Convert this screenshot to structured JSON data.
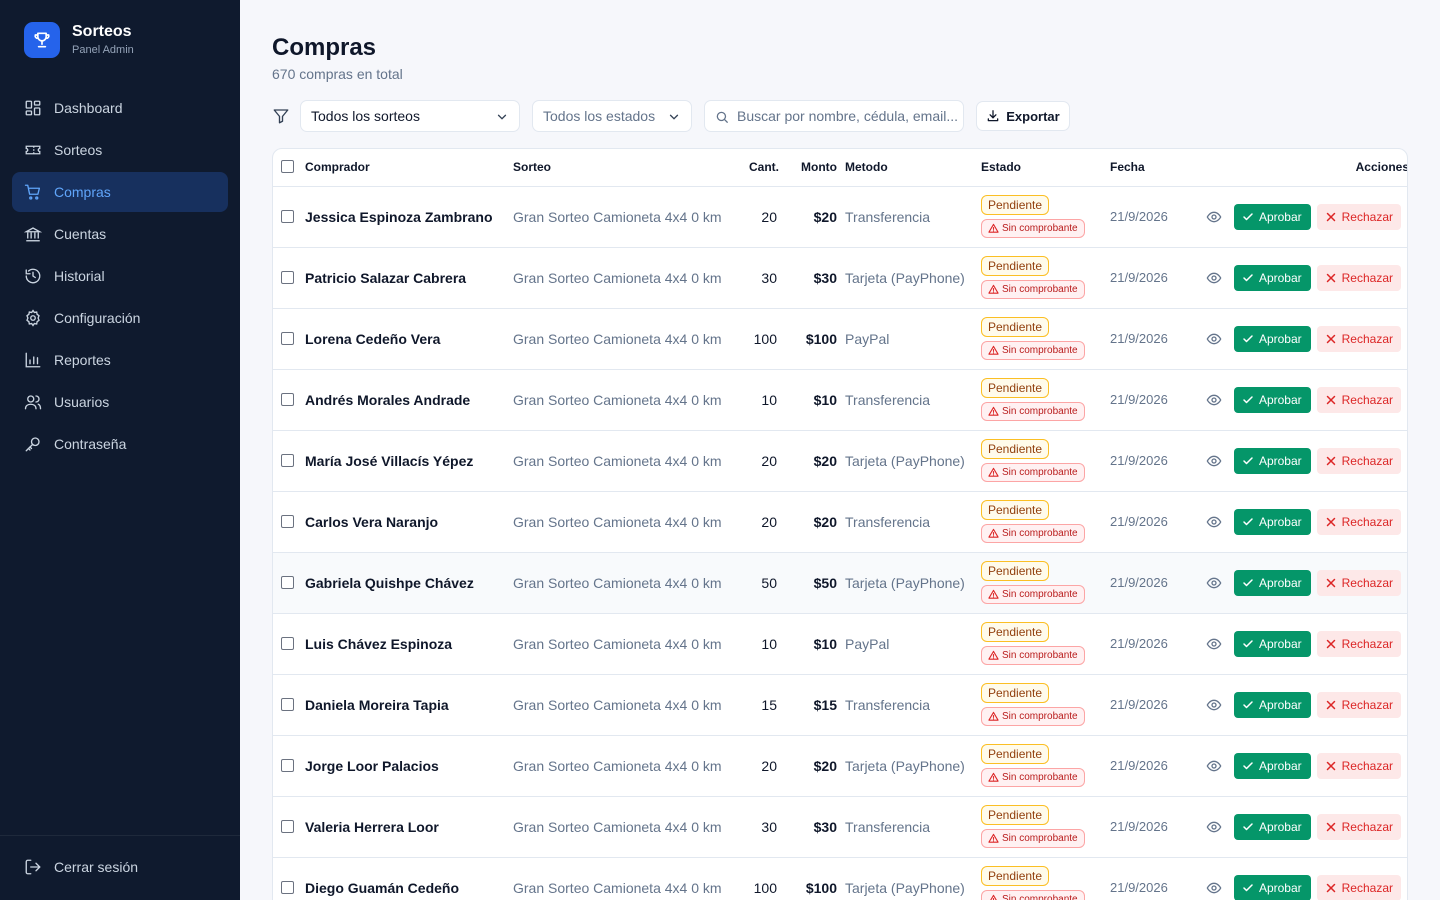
{
  "brand": {
    "title": "Sorteos",
    "subtitle": "Panel Admin",
    "icon": "trophy-icon"
  },
  "sidebar": {
    "items": [
      {
        "label": "Dashboard",
        "icon": "dashboard-icon",
        "active": false
      },
      {
        "label": "Sorteos",
        "icon": "ticket-icon",
        "active": false
      },
      {
        "label": "Compras",
        "icon": "cart-icon",
        "active": true
      },
      {
        "label": "Cuentas",
        "icon": "bank-icon",
        "active": false
      },
      {
        "label": "Historial",
        "icon": "history-icon",
        "active": false
      },
      {
        "label": "Configuración",
        "icon": "gear-icon",
        "active": false
      },
      {
        "label": "Reportes",
        "icon": "bar-chart-icon",
        "active": false
      },
      {
        "label": "Usuarios",
        "icon": "users-icon",
        "active": false
      },
      {
        "label": "Contraseña",
        "icon": "key-icon",
        "active": false
      }
    ],
    "logout_label": "Cerrar sesión"
  },
  "page": {
    "title": "Compras",
    "subtitle": "670 compras en total"
  },
  "filters": {
    "raffle_selected": "Todos los sorteos",
    "status_selected": "Todos los estados",
    "search_placeholder": "Buscar por nombre, cédula, email...",
    "export_label": "Exportar"
  },
  "table": {
    "headers": {
      "buyer": "Comprador",
      "raffle": "Sorteo",
      "qty": "Cant.",
      "amount": "Monto",
      "method": "Metodo",
      "status": "Estado",
      "date": "Fecha",
      "actions": "Acciones"
    },
    "status_label": "Pendiente",
    "no_receipt_label": "Sin comprobante",
    "approve_label": "Aprobar",
    "reject_label": "Rechazar",
    "rows": [
      {
        "buyer": "Jessica Espinoza Zambrano",
        "raffle": "Gran Sorteo Camioneta 4x4 0 km",
        "qty": "20",
        "amount": "$20",
        "method": "Transferencia",
        "date": "21/9/2026"
      },
      {
        "buyer": "Patricio Salazar Cabrera",
        "raffle": "Gran Sorteo Camioneta 4x4 0 km",
        "qty": "30",
        "amount": "$30",
        "method": "Tarjeta (PayPhone)",
        "date": "21/9/2026"
      },
      {
        "buyer": "Lorena Cedeño Vera",
        "raffle": "Gran Sorteo Camioneta 4x4 0 km",
        "qty": "100",
        "amount": "$100",
        "method": "PayPal",
        "date": "21/9/2026"
      },
      {
        "buyer": "Andrés Morales Andrade",
        "raffle": "Gran Sorteo Camioneta 4x4 0 km",
        "qty": "10",
        "amount": "$10",
        "method": "Transferencia",
        "date": "21/9/2026"
      },
      {
        "buyer": "María José Villacís Yépez",
        "raffle": "Gran Sorteo Camioneta 4x4 0 km",
        "qty": "20",
        "amount": "$20",
        "method": "Tarjeta (PayPhone)",
        "date": "21/9/2026"
      },
      {
        "buyer": "Carlos Vera Naranjo",
        "raffle": "Gran Sorteo Camioneta 4x4 0 km",
        "qty": "20",
        "amount": "$20",
        "method": "Transferencia",
        "date": "21/9/2026"
      },
      {
        "buyer": "Gabriela Quishpe Chávez",
        "raffle": "Gran Sorteo Camioneta 4x4 0 km",
        "qty": "50",
        "amount": "$50",
        "method": "Tarjeta (PayPhone)",
        "date": "21/9/2026"
      },
      {
        "buyer": "Luis Chávez Espinoza",
        "raffle": "Gran Sorteo Camioneta 4x4 0 km",
        "qty": "10",
        "amount": "$10",
        "method": "PayPal",
        "date": "21/9/2026"
      },
      {
        "buyer": "Daniela Moreira Tapia",
        "raffle": "Gran Sorteo Camioneta 4x4 0 km",
        "qty": "15",
        "amount": "$15",
        "method": "Transferencia",
        "date": "21/9/2026"
      },
      {
        "buyer": "Jorge Loor Palacios",
        "raffle": "Gran Sorteo Camioneta 4x4 0 km",
        "qty": "20",
        "amount": "$20",
        "method": "Tarjeta (PayPhone)",
        "date": "21/9/2026"
      },
      {
        "buyer": "Valeria Herrera Loor",
        "raffle": "Gran Sorteo Camioneta 4x4 0 km",
        "qty": "30",
        "amount": "$30",
        "method": "Transferencia",
        "date": "21/9/2026"
      },
      {
        "buyer": "Diego Guamán Cedeño",
        "raffle": "Gran Sorteo Camioneta 4x4 0 km",
        "qty": "100",
        "amount": "$100",
        "method": "Tarjeta (PayPhone)",
        "date": "21/9/2026"
      }
    ]
  },
  "colors": {
    "sidebar_bg": "#0f1a2e",
    "accent": "#2563eb",
    "approve": "#059669",
    "reject": "#dc2626",
    "pending": "#fbbf24"
  }
}
